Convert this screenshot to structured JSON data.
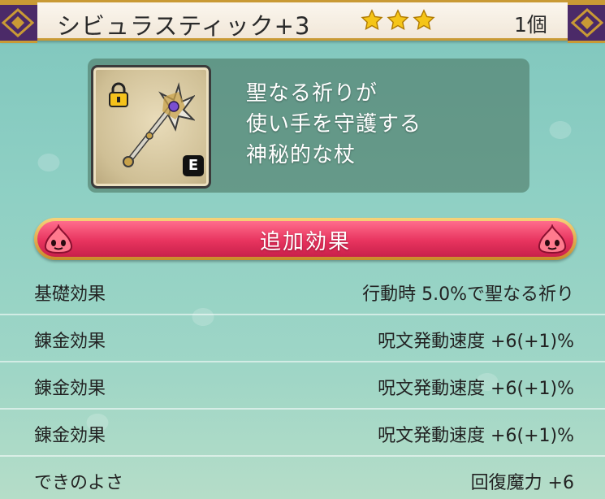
{
  "header": {
    "item_name": "シビュラスティック+3",
    "star_count": 3,
    "quantity": "1個"
  },
  "item": {
    "grade": "E",
    "locked": true,
    "description_lines": [
      "聖なる祈りが",
      "使い手を守護する",
      "神秘的な杖"
    ]
  },
  "banner": {
    "title": "追加効果"
  },
  "effects": [
    {
      "label": "基礎効果",
      "value": "行動時 5.0%で聖なる祈り"
    },
    {
      "label": "錬金効果",
      "value": "呪文発動速度 +6(+1)%"
    },
    {
      "label": "錬金効果",
      "value": "呪文発動速度 +6(+1)%"
    },
    {
      "label": "錬金効果",
      "value": "呪文発動速度 +6(+1)%"
    },
    {
      "label": "できのよさ",
      "value": "回復魔力 +6"
    }
  ],
  "colors": {
    "accent_gold": "#c99a35",
    "banner_red": "#e8345f",
    "corner_purple": "#4b2a68"
  }
}
